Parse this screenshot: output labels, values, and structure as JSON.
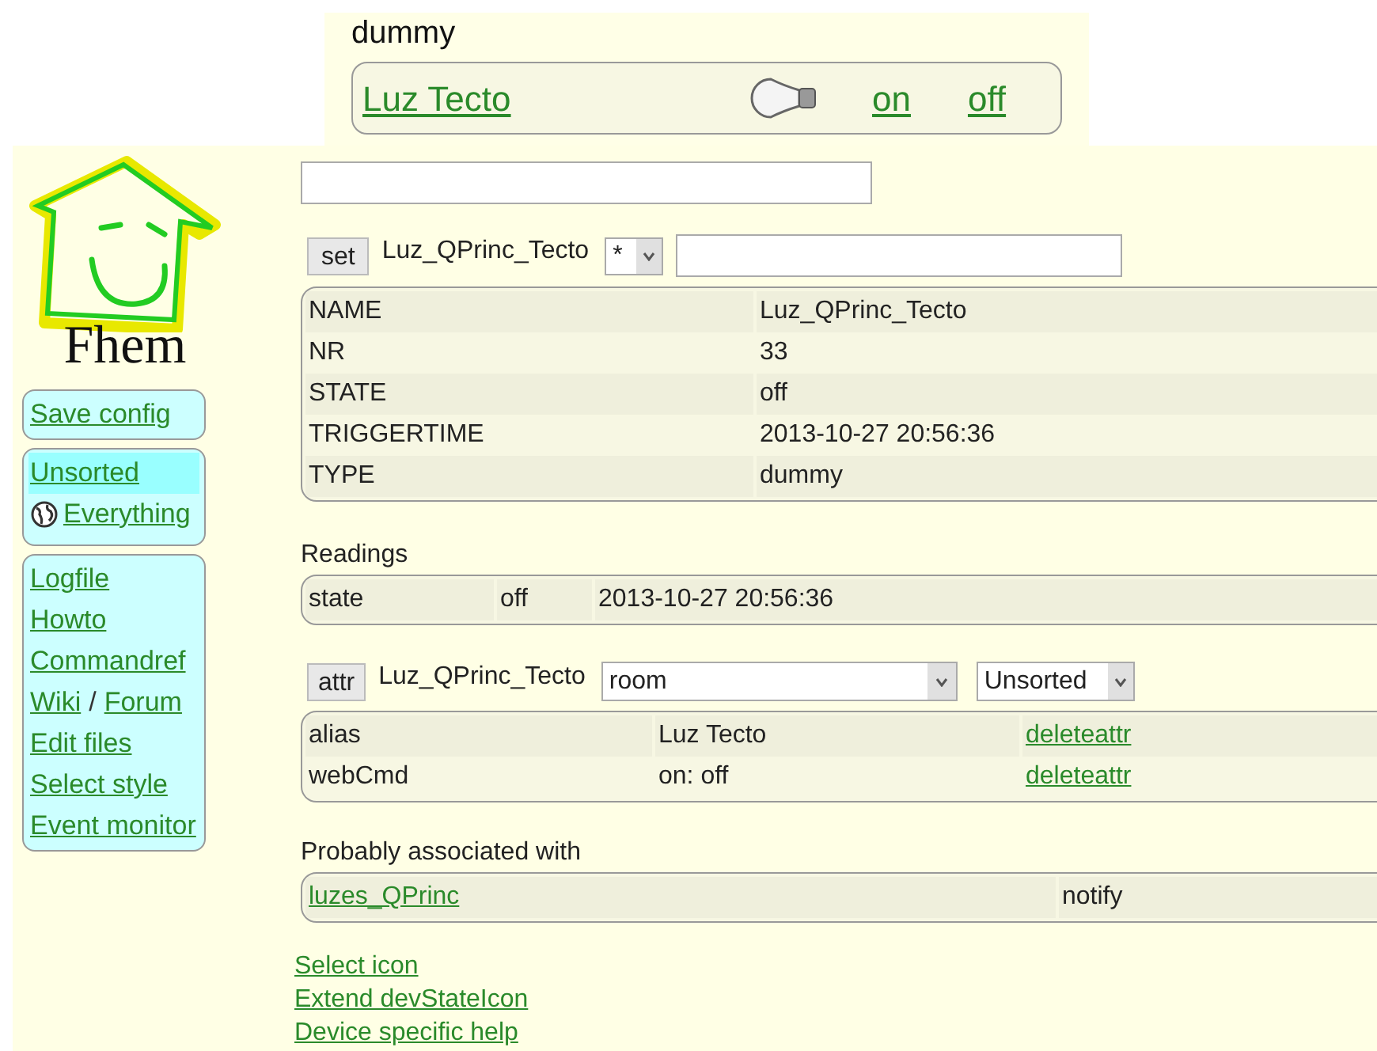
{
  "room_panel": {
    "title": "dummy",
    "device": {
      "label": "Luz Tecto",
      "commands": [
        "on",
        "off"
      ]
    }
  },
  "logo": {
    "text": "Fhem"
  },
  "sidebar": {
    "groups": [
      {
        "items": [
          {
            "kind": "link",
            "label": "Save config",
            "selected": false
          }
        ]
      },
      {
        "items": [
          {
            "kind": "link",
            "label": "Unsorted",
            "selected": true
          },
          {
            "kind": "globe",
            "label": "Everything",
            "selected": false
          }
        ]
      },
      {
        "items": [
          {
            "kind": "link",
            "label": "Logfile",
            "selected": false
          },
          {
            "kind": "link",
            "label": "Howto",
            "selected": false
          },
          {
            "kind": "link",
            "label": "Commandref",
            "selected": false
          },
          {
            "kind": "pair",
            "labels": [
              "Wiki",
              "Forum"
            ],
            "separator": "/",
            "selected": false
          },
          {
            "kind": "link",
            "label": "Edit files",
            "selected": false
          },
          {
            "kind": "link",
            "label": "Select style",
            "selected": false
          },
          {
            "kind": "link",
            "label": "Event monitor",
            "selected": false
          }
        ]
      }
    ]
  },
  "set_row": {
    "button": "set",
    "device": "Luz_QPrinc_Tecto",
    "select": "*"
  },
  "internals": [
    {
      "name": "NAME",
      "value": "Luz_QPrinc_Tecto"
    },
    {
      "name": "NR",
      "value": "33"
    },
    {
      "name": "STATE",
      "value": "off"
    },
    {
      "name": "TRIGGERTIME",
      "value": "2013-10-27 20:56:36"
    },
    {
      "name": "TYPE",
      "value": "dummy"
    }
  ],
  "readings": {
    "title": "Readings",
    "rows": [
      {
        "name": "state",
        "value": "off",
        "time": "2013-10-27 20:56:36"
      }
    ]
  },
  "attr_row": {
    "button": "attr",
    "device": "Luz_QPrinc_Tecto",
    "attribute": "room",
    "value": "Unsorted"
  },
  "attributes": [
    {
      "name": "alias",
      "value": "Luz Tecto",
      "action": "deleteattr"
    },
    {
      "name": "webCmd",
      "value": "on: off",
      "action": "deleteattr"
    }
  ],
  "associated": {
    "title": "Probably associated with",
    "rows": [
      {
        "name": "luzes_QPrinc",
        "type": "notify"
      }
    ]
  },
  "links": [
    "Select icon",
    "Extend devStateIcon",
    "Device specific help"
  ]
}
